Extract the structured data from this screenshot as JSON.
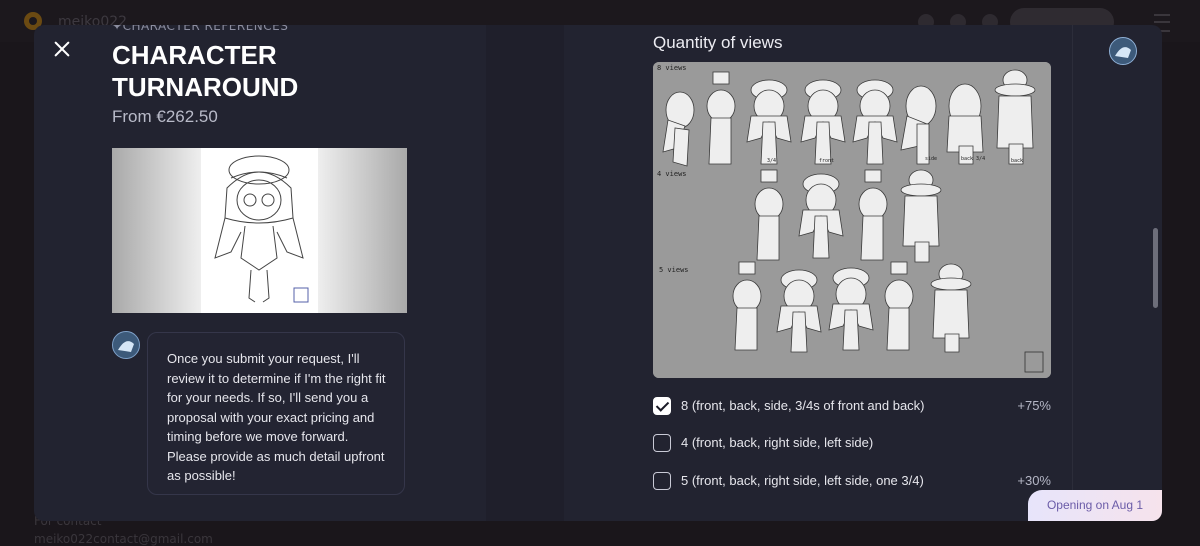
{
  "background": {
    "brand": "meiko022",
    "footer_line1": "For contact",
    "footer_line2": "meiko022contact@gmail.com"
  },
  "modal": {
    "eyebrow": "CHARACTER REFERENCES",
    "title": "CHARACTER TURNAROUND",
    "price": "From €262.50",
    "message": "Once you submit your request, I'll review it to determine if I'm the right fit for your needs. If so, I'll send you a proposal with your exact pricing and timing before we move forward. Please provide as much detail upfront as possible!",
    "views_section": {
      "title": "Quantity of views",
      "image_labels": {
        "row1": "8 views",
        "row2": "4 views",
        "row3": "5 views",
        "row1_captions": [
          "3/4",
          "front",
          "side",
          "back 3/4",
          "back"
        ]
      },
      "options": [
        {
          "label": "8 (front, back, side, 3/4s of front and back)",
          "price": "+75%",
          "checked": true
        },
        {
          "label": "4 (front, back, right side, left side)",
          "price": "",
          "checked": false
        },
        {
          "label": "5 (front, back, right side, left side, one 3/4)",
          "price": "+30%",
          "checked": false
        }
      ]
    },
    "badge": "Opening on Aug 1"
  },
  "colors": {
    "modal_bg": "#222330",
    "page_bg": "#1a161b",
    "badge_text": "#6b5ca8"
  }
}
